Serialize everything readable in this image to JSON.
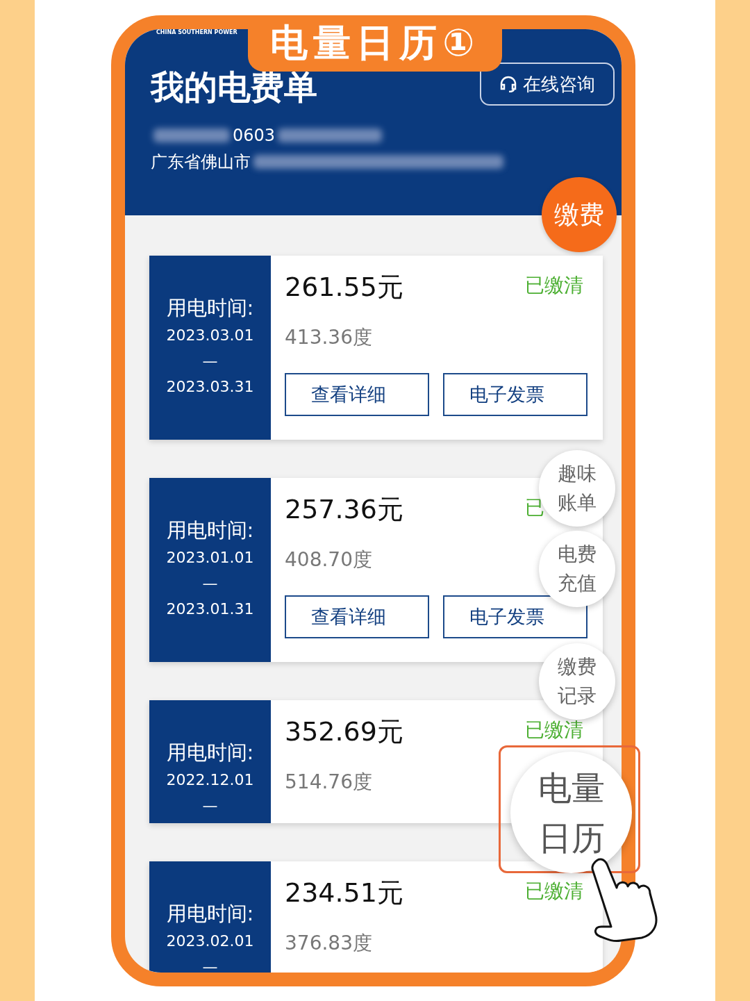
{
  "header": {
    "logo_text": "CHINA SOUTHERN POWER",
    "title": "我的电费单",
    "consult_button": "在线咨询",
    "account_visible": "0603",
    "address_visible": "广东省佛山市"
  },
  "banner": "电量日历①",
  "pay_button": "缴费",
  "bills": [
    {
      "period_label": "用电时间:",
      "start": "2023.03.01",
      "dash": "—",
      "end": "2023.03.31",
      "amount": "261.55元",
      "status": "已缴清",
      "usage": "413.36度",
      "buttons": [
        "查看详细",
        "电子发票"
      ]
    },
    {
      "period_label": "用电时间:",
      "start": "2023.01.01",
      "dash": "—",
      "end": "2023.01.31",
      "amount": "257.36元",
      "status": "已",
      "usage": "408.70度",
      "buttons": [
        "查看详细",
        "电子发票"
      ]
    },
    {
      "period_label": "用电时间:",
      "start": "2022.12.01",
      "dash": "—",
      "amount": "352.69元",
      "status": "已缴清",
      "usage": "514.76度"
    },
    {
      "period_label": "用电时间:",
      "start": "2023.02.01",
      "dash": "—",
      "amount": "234.51元",
      "status": "已缴清",
      "usage": "376.83度"
    }
  ],
  "float_menu": [
    {
      "lines": [
        "趣味",
        "账单"
      ]
    },
    {
      "lines": [
        "电费",
        "充值"
      ]
    },
    {
      "lines": [
        "缴费",
        "记录"
      ]
    }
  ],
  "highlight_button": {
    "lines": [
      "电量",
      "日历"
    ]
  }
}
